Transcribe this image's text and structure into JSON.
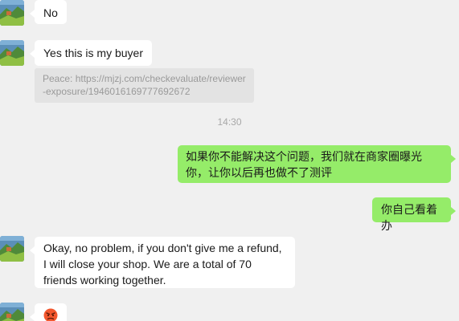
{
  "messages": [
    {
      "kind": "incoming",
      "text": "No"
    },
    {
      "kind": "incoming",
      "text": "Yes this is my buyer"
    },
    {
      "kind": "quote",
      "text": "Peace: https://mjzj.com/checkevaluate/reviewer-exposure/1946016169777692672"
    },
    {
      "kind": "time",
      "text": "14:30"
    },
    {
      "kind": "outgoing",
      "text": "如果你不能解决这个问题，我们就在商家圈曝光你，让你以后再也做不了测评"
    },
    {
      "kind": "outgoing",
      "text": "你自己看着办"
    },
    {
      "kind": "incoming",
      "text": "Okay, no problem, if you don't give me a refund, I will close your shop. We are a total of 70 friends working together."
    },
    {
      "kind": "incoming",
      "icon": "angry-face-emoji"
    }
  ],
  "colors": {
    "background": "#f0f0f0",
    "incoming_bubble": "#ffffff",
    "outgoing_bubble": "#95ec69",
    "quote_bubble": "#e3e3e3",
    "timestamp_text": "#a8a8a8"
  }
}
